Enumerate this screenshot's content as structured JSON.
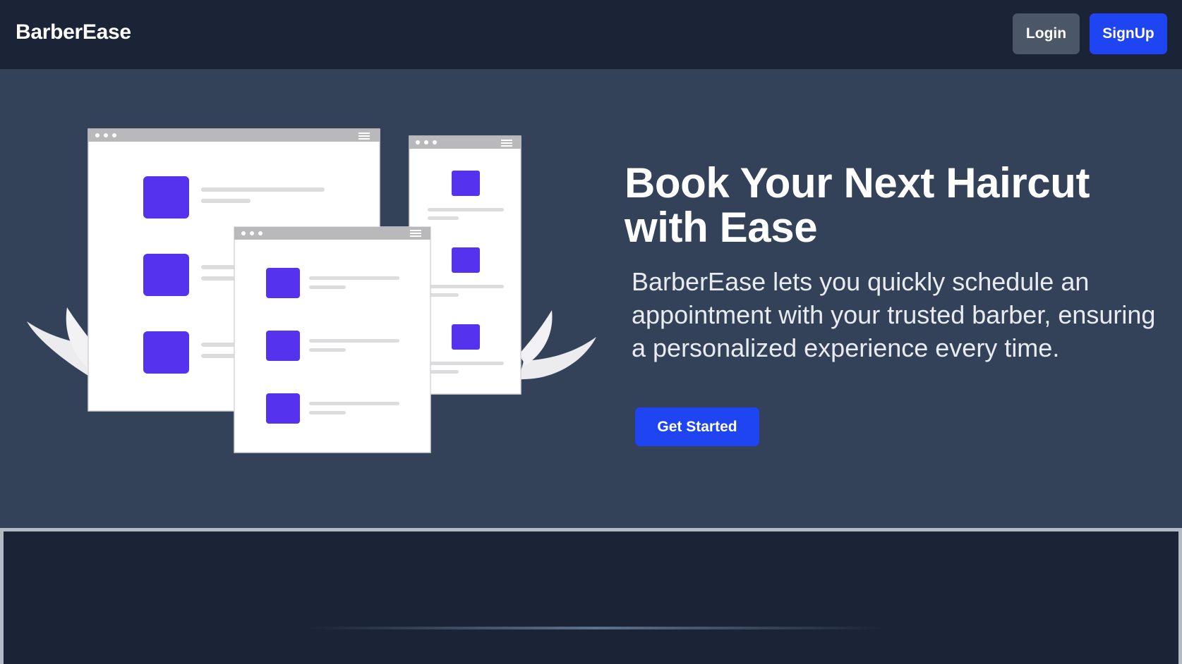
{
  "header": {
    "brand": "BarberEase",
    "login_label": "Login",
    "signup_label": "SignUp"
  },
  "hero": {
    "title": "Book Your Next Haircut with Ease",
    "description": "BarberEase lets you quickly schedule an appointment with your trusted barber, ensuring a personalized experience every time.",
    "cta_label": "Get Started",
    "illustration": "booking-windows-illustration"
  },
  "colors": {
    "navbar_bg": "#1a2436",
    "hero_bg": "#334259",
    "primary_button": "#1f44f2",
    "secondary_button": "#4b5667",
    "accent_squares": "#5533ee"
  }
}
